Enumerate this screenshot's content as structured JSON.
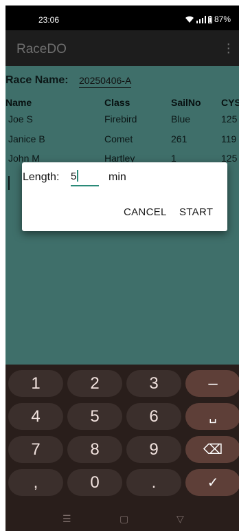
{
  "status_bar": {
    "time": "23:06",
    "battery": "87%"
  },
  "app_bar": {
    "title": "RaceDO",
    "menu_icon": "more-vert-icon"
  },
  "race": {
    "label": "Race Name:",
    "value": "20250406-A"
  },
  "table": {
    "headers": [
      "Name",
      "Class",
      "SailNo",
      "CYS"
    ],
    "rows": [
      [
        "Joe S",
        "Firebird",
        "Blue",
        "125"
      ],
      [
        "Janice B",
        "Comet",
        "261",
        "119"
      ],
      [
        "John M",
        "Hartley",
        "1",
        "125"
      ]
    ]
  },
  "dialog": {
    "label": "Length:",
    "value": "5",
    "unit": "min",
    "cancel": "CANCEL",
    "start": "START"
  },
  "keyboard": {
    "keys": [
      "1",
      "2",
      "3",
      "–",
      "4",
      "5",
      "6",
      "␣",
      "7",
      "8",
      "9",
      "⌫",
      ",",
      "0",
      ".",
      "✓"
    ]
  },
  "colors": {
    "teal_bg": "#3f6f6a",
    "accent": "#2a8a78",
    "keyboard_bg": "#291e1b"
  }
}
